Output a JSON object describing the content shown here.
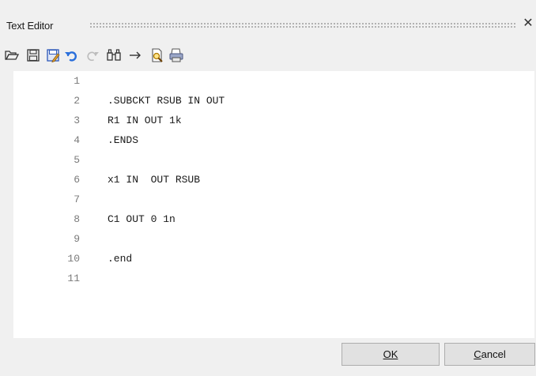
{
  "window": {
    "title": "Text Editor",
    "close_glyph": "✕"
  },
  "toolbar": {
    "buttons": [
      {
        "name": "open-icon"
      },
      {
        "name": "save-icon"
      },
      {
        "name": "save-as-icon"
      },
      {
        "name": "undo-icon"
      },
      {
        "name": "redo-icon"
      },
      {
        "name": "find-icon"
      },
      {
        "name": "goto-arrow-icon"
      },
      {
        "name": "print-preview-icon"
      },
      {
        "name": "print-icon"
      }
    ]
  },
  "editor": {
    "lines": [
      {
        "num": "1",
        "text": ""
      },
      {
        "num": "2",
        "text": ".SUBCKT RSUB IN OUT"
      },
      {
        "num": "3",
        "text": "R1 IN OUT 1k"
      },
      {
        "num": "4",
        "text": ".ENDS"
      },
      {
        "num": "5",
        "text": ""
      },
      {
        "num": "6",
        "text": "x1 IN  OUT RSUB"
      },
      {
        "num": "7",
        "text": ""
      },
      {
        "num": "8",
        "text": "C1 OUT 0 1n"
      },
      {
        "num": "9",
        "text": ""
      },
      {
        "num": "10",
        "text": ".end"
      },
      {
        "num": "11",
        "text": ""
      }
    ]
  },
  "buttons": {
    "ok_label": "OK",
    "cancel_label": "Cancel"
  },
  "colors": {
    "undo": "#2a6fdb",
    "redo": "#b8b8b8",
    "save_accent": "#3b6fd1"
  }
}
